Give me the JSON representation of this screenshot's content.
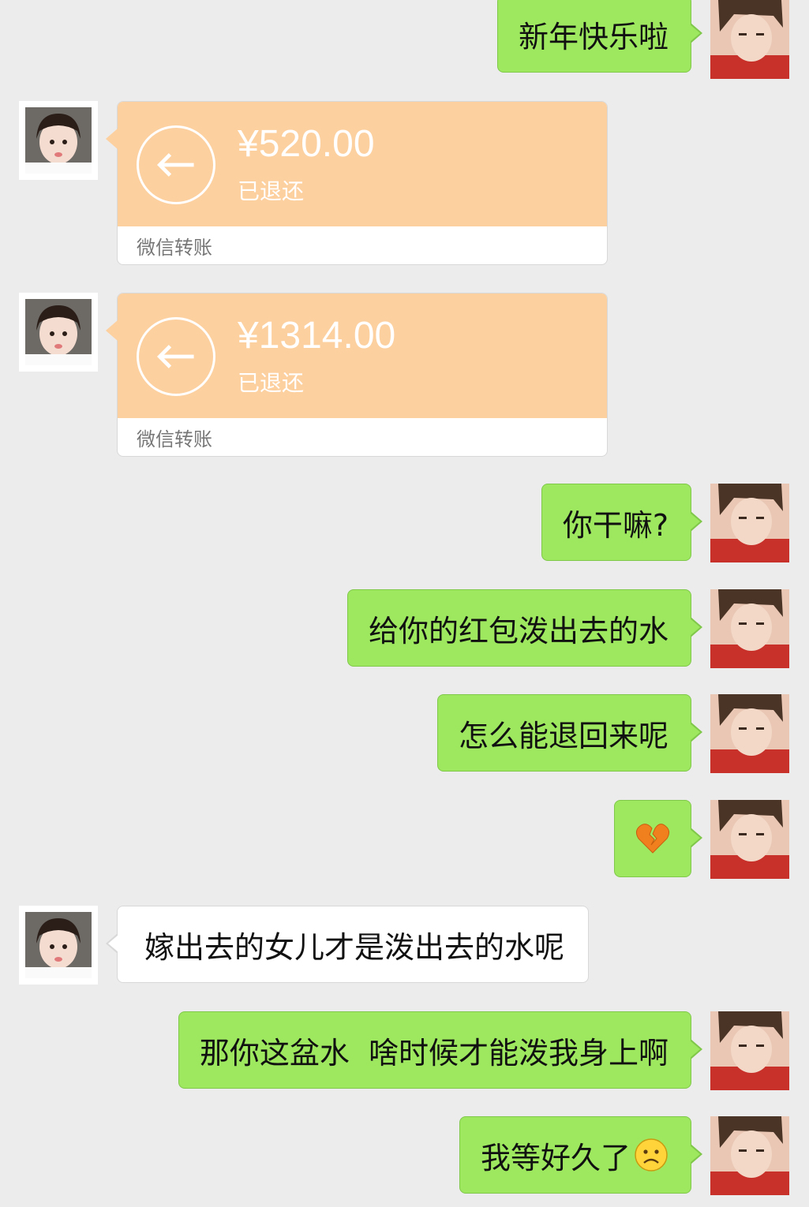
{
  "messages": [
    {
      "from": "me",
      "text": "新年快乐啦"
    },
    {
      "from": "her",
      "kind": "transfer",
      "amount": "¥520.00",
      "status": "已退还",
      "label": "微信转账"
    },
    {
      "from": "her",
      "kind": "transfer",
      "amount": "¥1314.00",
      "status": "已退还",
      "label": "微信转账"
    },
    {
      "from": "me",
      "text": "你干嘛?"
    },
    {
      "from": "me",
      "text": "给你的红包泼出去的水"
    },
    {
      "from": "me",
      "text": "怎么能退回来呢"
    },
    {
      "from": "me",
      "emoji": "broken-heart-emoji"
    },
    {
      "from": "her",
      "text": "嫁出去的女儿才是泼出去的水呢"
    },
    {
      "from": "me",
      "text": "那你这盆水  啥时候才能泼我身上啊"
    },
    {
      "from": "me",
      "text": "我等好久了",
      "emoji": "frowning-face-emoji"
    }
  ],
  "colors": {
    "background": "#ececec",
    "outgoing_bubble": "#9ee85f",
    "incoming_bubble": "#ffffff",
    "transfer_card": "#fdd0a0"
  }
}
